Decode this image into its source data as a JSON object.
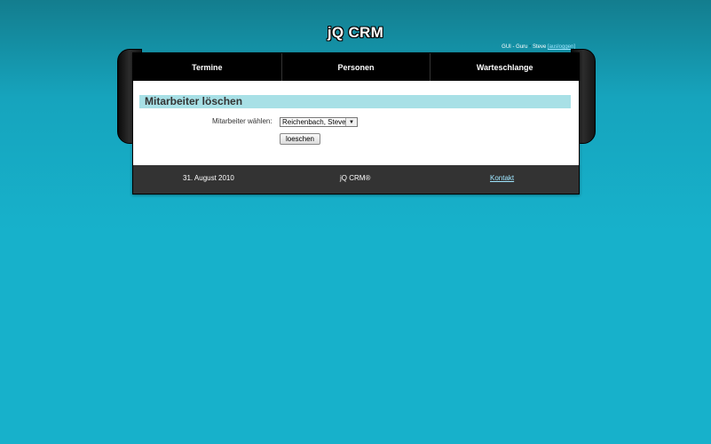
{
  "site": {
    "title": "jQ CRM"
  },
  "user": {
    "role": "GUI - Guru",
    "separator": "•",
    "name": "Steve",
    "logout_label": "[ausloggen]"
  },
  "nav": {
    "items": [
      "Termine",
      "Personen",
      "Warteschlange"
    ]
  },
  "section": {
    "title": "Mitarbeiter löschen"
  },
  "form": {
    "label": "Mitarbeiter  wählen:",
    "select_value": "Reichenbach, Steve",
    "select_arrow": "▼",
    "submit_label": "loeschen"
  },
  "footer": {
    "date": "31. August 2010",
    "brand": "jQ CRM®",
    "contact": "Kontakt"
  }
}
